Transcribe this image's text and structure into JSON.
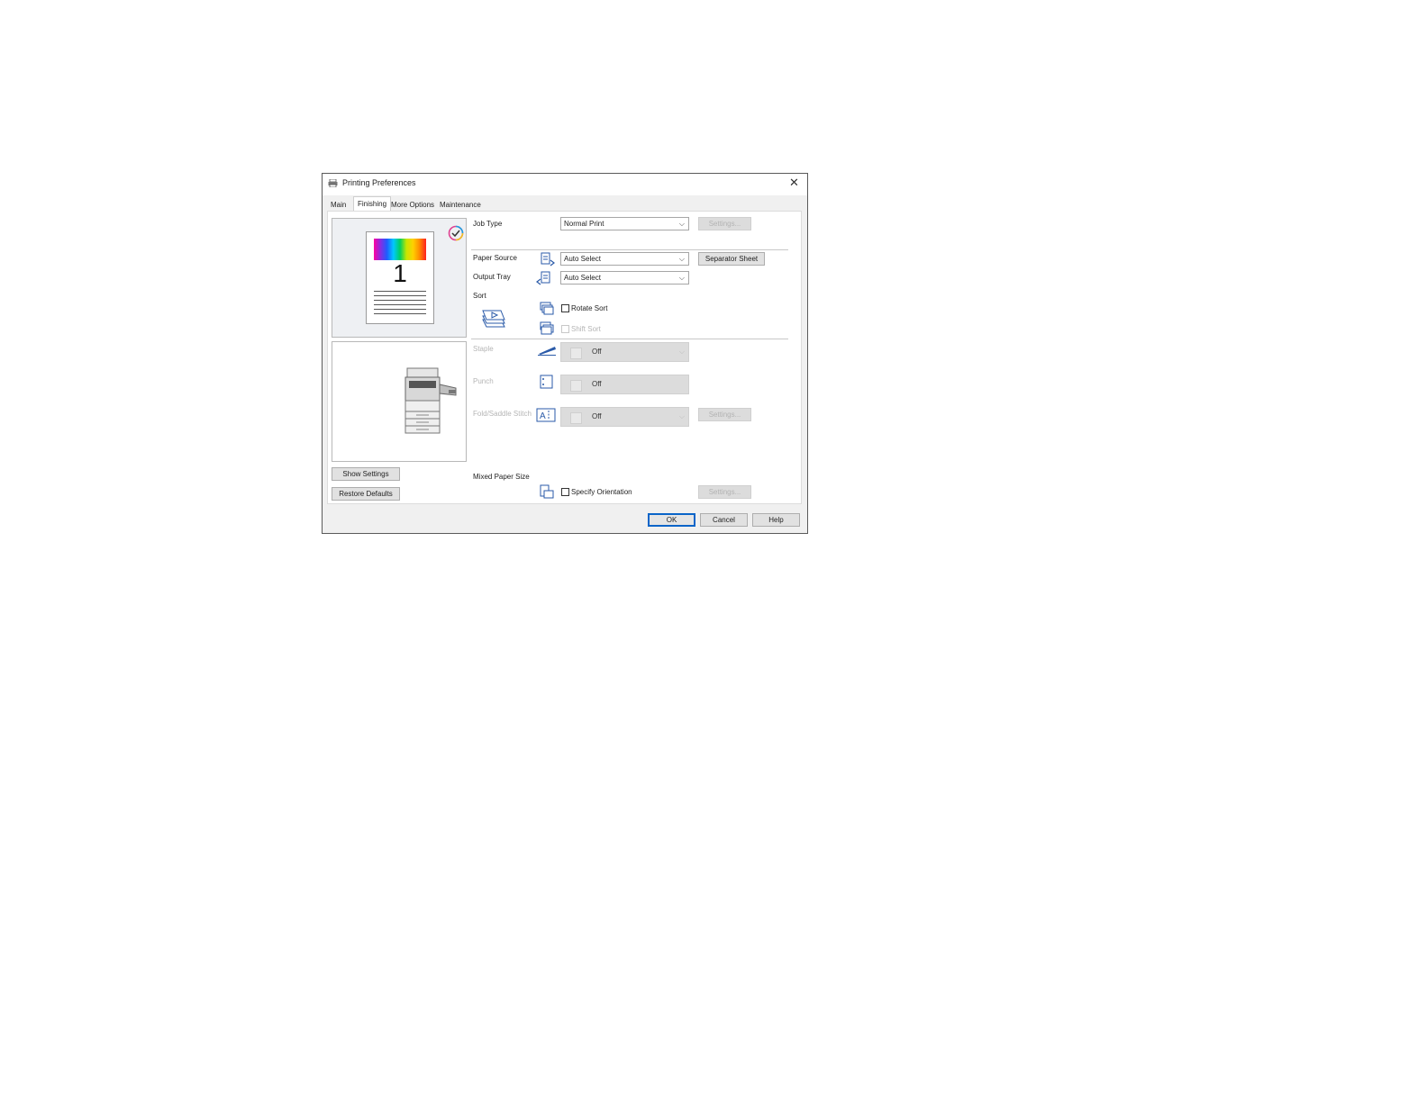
{
  "window": {
    "title": "Printing Preferences",
    "close_glyph": "✕"
  },
  "tabs": [
    {
      "label": "Main",
      "active": false
    },
    {
      "label": "Finishing",
      "active": true
    },
    {
      "label": "More Options",
      "active": false
    },
    {
      "label": "Maintenance",
      "active": false
    }
  ],
  "preview": {
    "page_number": "1"
  },
  "left_buttons": {
    "show_settings": "Show Settings",
    "restore_defaults": "Restore Defaults"
  },
  "job_type": {
    "label": "Job Type",
    "value": "Normal Print",
    "settings_button": "Settings..."
  },
  "paper_source": {
    "label": "Paper Source",
    "value": "Auto Select",
    "separator_button": "Separator Sheet"
  },
  "output_tray": {
    "label": "Output Tray",
    "value": "Auto Select"
  },
  "sort": {
    "label": "Sort",
    "rotate_sort": "Rotate Sort",
    "shift_sort": "Shift Sort"
  },
  "staple": {
    "label": "Staple",
    "value": "Off"
  },
  "punch": {
    "label": "Punch",
    "value": "Off"
  },
  "fold": {
    "label": "Fold/Saddle Stitch",
    "value": "Off",
    "settings_button": "Settings..."
  },
  "mixed_paper": {
    "label": "Mixed Paper Size",
    "specify_orientation": "Specify Orientation",
    "settings_button": "Settings..."
  },
  "footer": {
    "ok": "OK",
    "cancel": "Cancel",
    "help": "Help"
  },
  "colors": {
    "accent": "#0a64c8",
    "icon_blue": "#2a5aa8",
    "disabled_text": "#b5b5b5"
  }
}
